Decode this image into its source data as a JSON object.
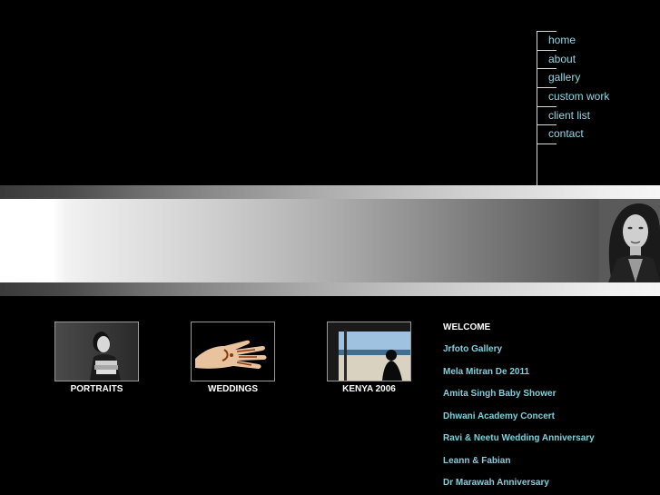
{
  "menu": {
    "items": [
      {
        "label": "home"
      },
      {
        "label": "about"
      },
      {
        "label": "gallery"
      },
      {
        "label": "custom work"
      },
      {
        "label": "client list"
      },
      {
        "label": "contact"
      }
    ]
  },
  "colors": {
    "background": "#000000",
    "menu_link": "#8fd9e6",
    "news_link": "#7fd0dc",
    "caption": "#ffffff"
  },
  "gallery": {
    "thumbs": [
      {
        "caption": "PORTRAITS",
        "icon": "portrait-photo"
      },
      {
        "caption": "WEDDINGS",
        "icon": "henna-hand-photo"
      },
      {
        "caption": "KENYA 2006",
        "icon": "beach-photo"
      }
    ]
  },
  "news": {
    "heading": "WELCOME",
    "items": [
      {
        "label": "Jrfoto Gallery"
      },
      {
        "label": "Mela Mitran De 2011"
      },
      {
        "label": "Amita Singh Baby Shower"
      },
      {
        "label": "Dhwani Academy Concert"
      },
      {
        "label": "Ravi & Neetu Wedding Anniversary"
      },
      {
        "label": "Leann & Fabian"
      },
      {
        "label": "Dr Marawah Anniversary"
      }
    ]
  }
}
